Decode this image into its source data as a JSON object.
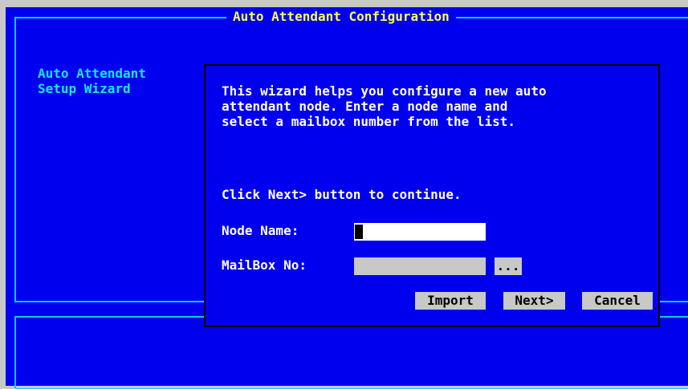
{
  "window": {
    "title": "Auto Attendant Configuration"
  },
  "sidebar": {
    "line1": "Auto Attendant",
    "line2": "Setup Wizard"
  },
  "dialog": {
    "description_lines": [
      "This wizard helps you configure a new auto",
      "attendant node. Enter a node name and",
      "select a mailbox number from the list."
    ],
    "continue_text": "Click Next> button to continue.",
    "node_name": {
      "label": "Node Name:",
      "value": ""
    },
    "mailbox_no": {
      "label": "MailBox No:",
      "value": ""
    },
    "browse_label": "...",
    "buttons": {
      "import": "Import",
      "next": "Next>",
      "cancel": "Cancel"
    }
  },
  "colors": {
    "background": "#0000ee",
    "frame_border": "#14c8ff",
    "title_text": "#ffff50",
    "side_text": "#14e8ff",
    "dialog_text": "#ffffff",
    "button_face": "#c8c8c8",
    "input_active": "#ffffff"
  }
}
